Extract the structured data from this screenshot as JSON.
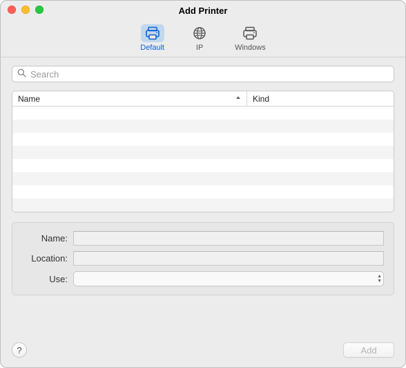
{
  "window": {
    "title": "Add Printer"
  },
  "toolbar": {
    "items": [
      {
        "label": "Default",
        "selected": true
      },
      {
        "label": "IP",
        "selected": false
      },
      {
        "label": "Windows",
        "selected": false
      }
    ]
  },
  "search": {
    "placeholder": "Search",
    "value": ""
  },
  "table": {
    "columns": {
      "name": "Name",
      "kind": "Kind"
    },
    "sort": {
      "column": "name",
      "direction": "asc"
    },
    "rows": []
  },
  "form": {
    "name_label": "Name:",
    "name_value": "",
    "location_label": "Location:",
    "location_value": "",
    "use_label": "Use:",
    "use_value": ""
  },
  "footer": {
    "help_symbol": "?",
    "add_label": "Add",
    "add_enabled": false
  }
}
